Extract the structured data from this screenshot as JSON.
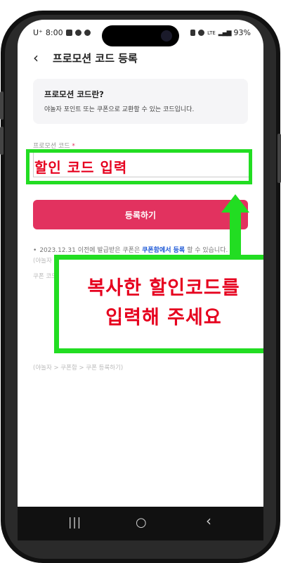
{
  "status_bar": {
    "carrier": "U⁺",
    "time": "8:00",
    "battery": "93%",
    "network": "LTE"
  },
  "header": {
    "back_glyph": "‹",
    "title": "프로모션 코드 등록"
  },
  "info_box": {
    "question": "프로모션 코드란?",
    "description": "야놀자 포인트 또는 쿠폰으로 교환할 수 있는 코드입니다."
  },
  "form": {
    "label": "프로모션 코드",
    "required_mark": "*",
    "input_value": "할인 코드 입력",
    "submit_label": "등록하기"
  },
  "notes": {
    "line1_prefix": "2023.12.31 이전에 발급받은 쿠폰은",
    "line1_link": "쿠폰함에서 등록",
    "line1_suffix": "할 수 있습니다.",
    "faint1": "(야놀자 > 쿠폰함 > 쿠폰 등록하기)",
    "faint2": "쿠폰 코드는 영문 대소문자를 구분합니다.",
    "faint3": "(야놀자 > 쿠폰함 > 쿠폰 등록하기)"
  },
  "callout": {
    "line1": "복사한 할인코드를",
    "line2": "입력해 주세요"
  },
  "nav_bar": {
    "recent": "|||",
    "home": "○",
    "back": "‹"
  },
  "colors": {
    "accent": "#e2325f",
    "highlight": "#22dd22",
    "callout_text": "#e6001e",
    "link": "#1a56d6"
  }
}
